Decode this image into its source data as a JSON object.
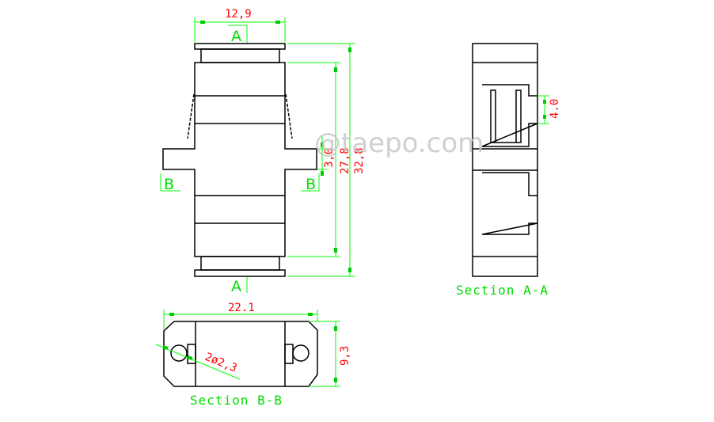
{
  "drawing": {
    "watermark": "@taepo.com",
    "front_view": {
      "dimensions": {
        "width": "12,9",
        "inner_height": "27,8",
        "overall_height": "32,8",
        "wing_thickness": "3,0"
      },
      "section_markers": {
        "top": "A",
        "bottom": "A",
        "left": "B",
        "right": "B"
      }
    },
    "section_a_a": {
      "title": "Section A-A",
      "dimensions": {
        "slot_height": "4.0"
      }
    },
    "section_b_b": {
      "title": "Section B-B",
      "dimensions": {
        "width": "22.1",
        "height": "9,3",
        "holes": "2ø2,3"
      }
    },
    "colors": {
      "outline": "#000000",
      "dimension_line": "#00ff00",
      "dimension_text": "#ff0000",
      "label_text": "#00dd00",
      "watermark": "#c8c8c8"
    }
  }
}
